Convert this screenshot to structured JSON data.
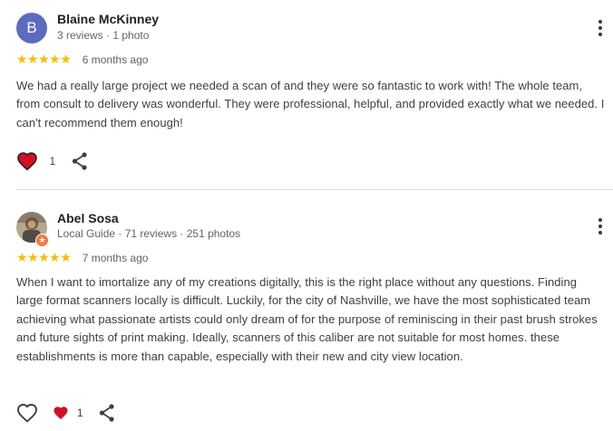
{
  "reviews": [
    {
      "author": "Blaine McKinney",
      "avatar_letter": "B",
      "meta": "3 reviews · 1 photo",
      "stars": "★★★★★",
      "rating": 5,
      "date": "6 months ago",
      "text": "We had a really large project we needed a scan of and they were so fantastic to work with! The whole team, from consult to delivery was wonderful. They were professional, helpful, and provided exactly what we needed. I can't recommend them enough!",
      "like_count": "1",
      "liked": true
    },
    {
      "author": "Abel Sosa",
      "meta": "Local Guide · 71 reviews · 251 photos",
      "stars": "★★★★★",
      "rating": 5,
      "date": "7 months ago",
      "text": "When I want to imortalize any of my creations digitally, this is the right place without any questions. Finding large format scanners locally is difficult. Luckily, for the city of Nashville, we have the most sophisticated team achieving what passionate artists could only dream of for the purpose of reminiscing in their past brush strokes and future sights of print making. Ideally, scanners of this caliber are not suitable for most homes. these establishments is more than capable, especially with their new and city view location.",
      "like_count": "1",
      "liked": false
    }
  ],
  "icons": {
    "like": "heart-icon",
    "share": "share-icon",
    "menu": "more-vert-icon",
    "local_guide": "local-guide-badge-icon"
  },
  "colors": {
    "star": "#fbbc04",
    "heart_red": "#d50f25",
    "avatar_b": "#5c6bc0",
    "local_guide_badge": "#f4793a",
    "divider": "#dadce0"
  }
}
